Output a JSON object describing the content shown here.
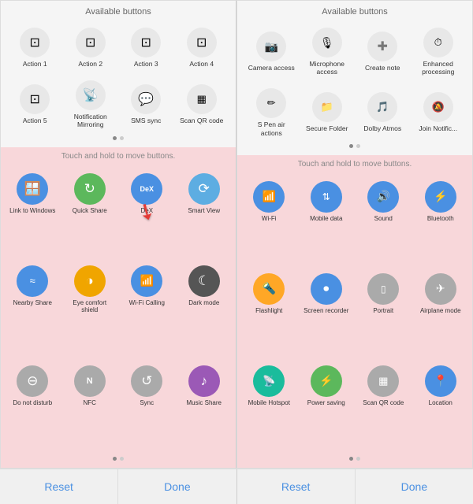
{
  "panels": [
    {
      "id": "left",
      "available": {
        "title": "Available buttons",
        "buttons": [
          {
            "label": "Action 1",
            "icon": "⊞"
          },
          {
            "label": "Action 2",
            "icon": "⊞"
          },
          {
            "label": "Action 3",
            "icon": "⊞"
          },
          {
            "label": "Action 4",
            "icon": "⊞"
          },
          {
            "label": "Action 5",
            "icon": "⊞"
          },
          {
            "label": "Notification Mirroring",
            "icon": "📡"
          },
          {
            "label": "SMS sync",
            "icon": "💬"
          },
          {
            "label": "Scan QR code",
            "icon": "▦"
          }
        ]
      },
      "active": {
        "title": "Touch and hold to move buttons.",
        "buttons": [
          {
            "label": "Link to Windows",
            "icon": "🪟",
            "color": "blue"
          },
          {
            "label": "Quick Share",
            "icon": "↻",
            "color": "green"
          },
          {
            "label": "DeX",
            "icon": "DeX",
            "color": "blue",
            "has_arrow": true
          },
          {
            "label": "Smart View",
            "icon": "⟳",
            "color": "blue"
          },
          {
            "label": "Nearby Share",
            "icon": "≈",
            "color": "blue"
          },
          {
            "label": "Eye comfort shield",
            "icon": "◑",
            "color": "orange"
          },
          {
            "label": "Wi-Fi Calling",
            "icon": "📶",
            "color": "blue"
          },
          {
            "label": "Dark mode",
            "icon": "☾",
            "color": "dark"
          },
          {
            "label": "Do not disturb",
            "icon": "⊖",
            "color": "gray"
          },
          {
            "label": "NFC",
            "icon": "N",
            "color": "gray"
          },
          {
            "label": "Sync",
            "icon": "↺",
            "color": "gray"
          },
          {
            "label": "Music Share",
            "icon": "♪",
            "color": "purple"
          }
        ]
      },
      "footer": {
        "reset": "Reset",
        "done": "Done"
      }
    },
    {
      "id": "right",
      "available": {
        "title": "Available buttons",
        "buttons": [
          {
            "label": "Camera access",
            "icon": "📷"
          },
          {
            "label": "Microphone access",
            "icon": "🎙"
          },
          {
            "label": "Create note",
            "icon": "➕"
          },
          {
            "label": "Enhanced processing",
            "icon": "⏱"
          },
          {
            "label": "S Pen air actions",
            "icon": "✏"
          },
          {
            "label": "Secure Folder",
            "icon": "📁"
          },
          {
            "label": "Dolby Atmos",
            "icon": "🎵"
          },
          {
            "label": "Join Notific...",
            "icon": "🔔"
          }
        ]
      },
      "active": {
        "title": "Touch and hold to move buttons.",
        "buttons": [
          {
            "label": "Wi-Fi",
            "icon": "📶",
            "color": "blue"
          },
          {
            "label": "Mobile data",
            "icon": "↑↓",
            "color": "blue"
          },
          {
            "label": "Sound",
            "icon": "🔊",
            "color": "blue"
          },
          {
            "label": "Bluetooth",
            "icon": "⚡",
            "color": "blue"
          },
          {
            "label": "Flashlight",
            "icon": "🔦",
            "color": "amber"
          },
          {
            "label": "Screen recorder",
            "icon": "⏺",
            "color": "blue"
          },
          {
            "label": "Portrait",
            "icon": "▭",
            "color": "gray"
          },
          {
            "label": "Airplane mode",
            "icon": "✈",
            "color": "gray"
          },
          {
            "label": "Mobile Hotspot",
            "icon": "📡",
            "color": "teal"
          },
          {
            "label": "Power saving",
            "icon": "⚡",
            "color": "green"
          },
          {
            "label": "Scan QR code",
            "icon": "▦",
            "color": "gray"
          },
          {
            "label": "Location",
            "icon": "📍",
            "color": "blue"
          }
        ]
      },
      "footer": {
        "reset": "Reset",
        "done": "Done"
      }
    }
  ]
}
